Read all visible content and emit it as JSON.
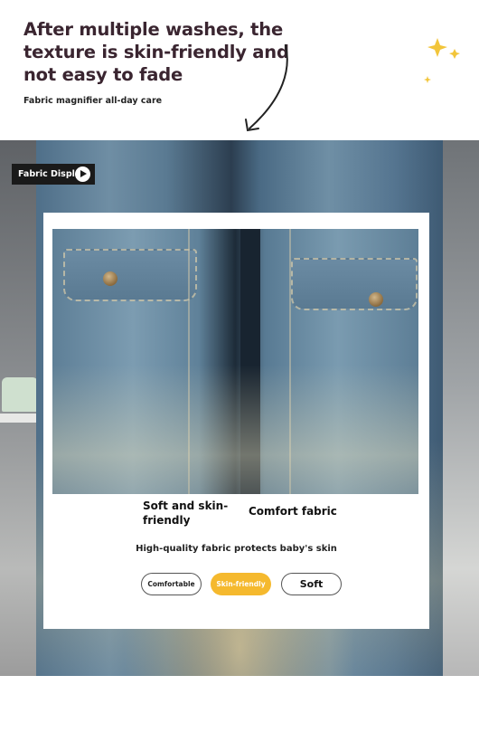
{
  "header": {
    "headline": "After multiple washes, the texture is skin-friendly and not easy to fade",
    "subline": "Fabric magnifier all-day care"
  },
  "tag": {
    "label": "Fabric Display",
    "icon": "play-icon"
  },
  "features": {
    "label_a": "Soft and skin-friendly",
    "label_b": "Comfort fabric",
    "description": "High-quality fabric protects baby's skin"
  },
  "pills": [
    {
      "label": "Comfortable",
      "selected": false
    },
    {
      "label": "Skin-friendly",
      "selected": true
    },
    {
      "label": "Soft",
      "selected": false
    }
  ],
  "colors": {
    "headline": "#3a2530",
    "accent_pill": "#f5b92e",
    "denim": "#5e7f97",
    "tag_bg": "#1a1a1a"
  }
}
